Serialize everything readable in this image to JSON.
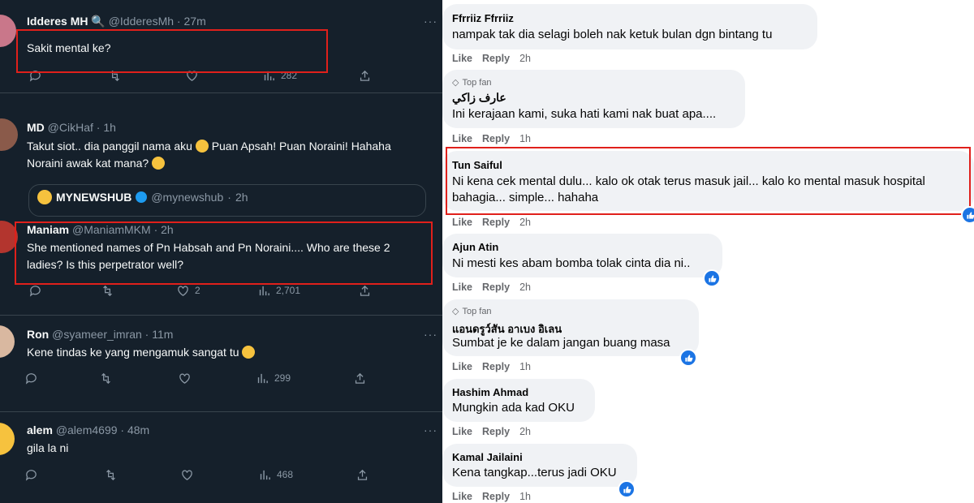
{
  "twitter": {
    "tweets": [
      {
        "name": "Idderes MH",
        "handle": "@IdderesMh",
        "time": "27m",
        "text": "Sakit mental ke?",
        "views": "282"
      },
      {
        "name": "MD",
        "handle": "@CikHaf",
        "time": "1h",
        "text1": "Takut siot.. dia panggil nama aku",
        "text1b": "Puan Apsah! Puan Noraini! Hahaha",
        "text2": "Noraini awak kat mana?",
        "quote": {
          "name": "MYNEWSHUB",
          "handle": "@mynewshub",
          "time": "2h"
        }
      },
      {
        "name": "Maniam",
        "handle": "@ManiamMKM",
        "time": "2h",
        "text": "She mentioned names of Pn Habsah and Pn Noraini.... Who are these 2 ladies? Is this perpetrator well?",
        "likes": "2",
        "views": "2,701"
      },
      {
        "name": "Ron",
        "handle": "@syameer_imran",
        "time": "11m",
        "text": "Kene tindas ke yang mengamuk sangat tu",
        "views": "299"
      },
      {
        "name": "alem",
        "handle": "@alem4699",
        "time": "48m",
        "text": "gila la ni",
        "views": "468"
      }
    ]
  },
  "facebook": {
    "like_label": "Like",
    "reply_label": "Reply",
    "top_fan_label": "Top fan",
    "comments": [
      {
        "name": "Ffrriiz Ffrriiz",
        "text": "nampak tak dia selagi boleh nak ketuk bulan dgn bintang tu",
        "time": "2h"
      },
      {
        "name": "عارف زاكي",
        "text": "Ini kerajaan kami, suka hati kami nak buat apa....",
        "time": "1h"
      },
      {
        "name": "Tun Saiful",
        "text1": "Ni kena cek mental dulu... kalo ok otak terus masuk jail... kalo ko mental masuk hospital",
        "text2": "bahagia... simple... hahaha",
        "time": "2h"
      },
      {
        "name": "Ajun Atin",
        "text": "Ni mesti kes abam bomba tolak cinta dia ni..",
        "time": "2h"
      },
      {
        "name": "แอนดรูว์สัน อาเบง อิเลน",
        "text": "Sumbat je ke dalam jangan buang masa",
        "time": "1h"
      },
      {
        "name": "Hashim Ahmad",
        "text": "Mungkin ada kad OKU",
        "time": "2h"
      },
      {
        "name": "Kamal Jailaini",
        "text": "Kena tangkap...terus jadi OKU",
        "time": "1h"
      }
    ]
  },
  "colors": {
    "twitter_bg": "#15202b",
    "highlight": "#e0201b",
    "fb_bubble": "#f0f2f5",
    "like_blue": "#1b74e4"
  }
}
